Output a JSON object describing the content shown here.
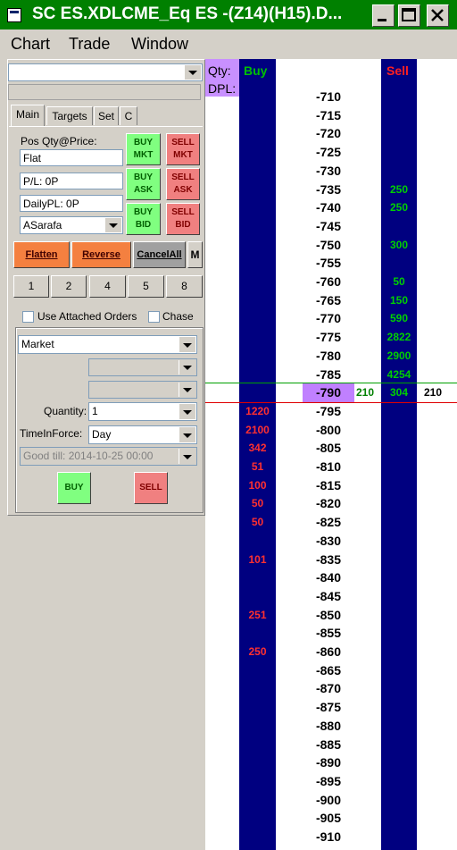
{
  "window": {
    "title": "SC ES.XDLCME_Eq ES -(Z14)(H15).D...",
    "minimize_glyph": "_",
    "maximize_glyph": "□",
    "close_glyph": "X"
  },
  "menu": [
    "Chart",
    "Trade",
    "Window"
  ],
  "panel": {
    "tabs": [
      "Main",
      "Targets",
      "Set",
      "C"
    ],
    "pos_qty_label": "Pos Qty@Price:",
    "pos_value": "Flat",
    "pl_value": "P/L: 0P",
    "daily_pl_value": "DailyPL: 0P",
    "account": "ASarafa",
    "buy_mkt": [
      "BUY",
      "MKT"
    ],
    "sell_mkt": [
      "SELL",
      "MKT"
    ],
    "buy_ask": [
      "BUY",
      "ASK"
    ],
    "sell_ask": [
      "SELL",
      "ASK"
    ],
    "buy_bid": [
      "BUY",
      "BID"
    ],
    "sell_bid": [
      "SELL",
      "BID"
    ],
    "flatten": "Flatten",
    "reverse": "Reverse",
    "cancel_all": "CancelAll",
    "m_button": "M",
    "qty_presets": [
      "1",
      "2",
      "4",
      "5",
      "8"
    ],
    "use_attached_orders": "Use Attached Orders",
    "chase": "Chase",
    "order_type": "Market",
    "quantity_label": "Quantity:",
    "quantity": "1",
    "tif_label": "TimeInForce:",
    "tif": "Day",
    "good_till": "Good till: 2014-10-25 00:00",
    "buy": "BUY",
    "sell": "SELL"
  },
  "ladder": {
    "qty_label": "Qty:",
    "dpl_label": "DPL:",
    "buy_header": "Buy",
    "sell_header": "Sell",
    "rows": [
      {
        "price": "-710",
        "bid": "",
        "ask": ""
      },
      {
        "price": "-715",
        "bid": "",
        "ask": ""
      },
      {
        "price": "-720",
        "bid": "",
        "ask": ""
      },
      {
        "price": "-725",
        "bid": "",
        "ask": ""
      },
      {
        "price": "-730",
        "bid": "",
        "ask": ""
      },
      {
        "price": "-735",
        "bid": "",
        "ask": "250"
      },
      {
        "price": "-740",
        "bid": "",
        "ask": "250"
      },
      {
        "price": "-745",
        "bid": "",
        "ask": ""
      },
      {
        "price": "-750",
        "bid": "",
        "ask": "300"
      },
      {
        "price": "-755",
        "bid": "",
        "ask": ""
      },
      {
        "price": "-760",
        "bid": "",
        "ask": "50"
      },
      {
        "price": "-765",
        "bid": "",
        "ask": "150"
      },
      {
        "price": "-770",
        "bid": "",
        "ask": "590"
      },
      {
        "price": "-775",
        "bid": "",
        "ask": "2822"
      },
      {
        "price": "-780",
        "bid": "",
        "ask": "2900"
      },
      {
        "price": "-785",
        "bid": "",
        "ask": "4254"
      },
      {
        "price": "-790",
        "bid": "",
        "ask": "304",
        "last": true,
        "vol_left": "210",
        "vol_right": "210"
      },
      {
        "price": "-795",
        "bid": "1220",
        "ask": ""
      },
      {
        "price": "-800",
        "bid": "2100",
        "ask": ""
      },
      {
        "price": "-805",
        "bid": "342",
        "ask": ""
      },
      {
        "price": "-810",
        "bid": "51",
        "ask": ""
      },
      {
        "price": "-815",
        "bid": "100",
        "ask": ""
      },
      {
        "price": "-820",
        "bid": "50",
        "ask": ""
      },
      {
        "price": "-825",
        "bid": "50",
        "ask": ""
      },
      {
        "price": "-830",
        "bid": "",
        "ask": ""
      },
      {
        "price": "-835",
        "bid": "101",
        "ask": ""
      },
      {
        "price": "-840",
        "bid": "",
        "ask": ""
      },
      {
        "price": "-845",
        "bid": "",
        "ask": ""
      },
      {
        "price": "-850",
        "bid": "251",
        "ask": ""
      },
      {
        "price": "-855",
        "bid": "",
        "ask": ""
      },
      {
        "price": "-860",
        "bid": "250",
        "ask": ""
      },
      {
        "price": "-865",
        "bid": "",
        "ask": ""
      },
      {
        "price": "-870",
        "bid": "",
        "ask": ""
      },
      {
        "price": "-875",
        "bid": "",
        "ask": ""
      },
      {
        "price": "-880",
        "bid": "",
        "ask": ""
      },
      {
        "price": "-885",
        "bid": "",
        "ask": ""
      },
      {
        "price": "-890",
        "bid": "",
        "ask": ""
      },
      {
        "price": "-895",
        "bid": "",
        "ask": ""
      },
      {
        "price": "-900",
        "bid": "",
        "ask": ""
      },
      {
        "price": "-905",
        "bid": "",
        "ask": ""
      },
      {
        "price": "-910",
        "bid": "",
        "ask": ""
      }
    ]
  },
  "colors": {
    "title_bar": "#008000",
    "ladder_column": "#000080",
    "bid_qty": "#ff3030",
    "ask_qty": "#00d000",
    "last_price_bg": "#c080ff",
    "ask_line": "#00a000",
    "bid_line": "#e00000"
  }
}
